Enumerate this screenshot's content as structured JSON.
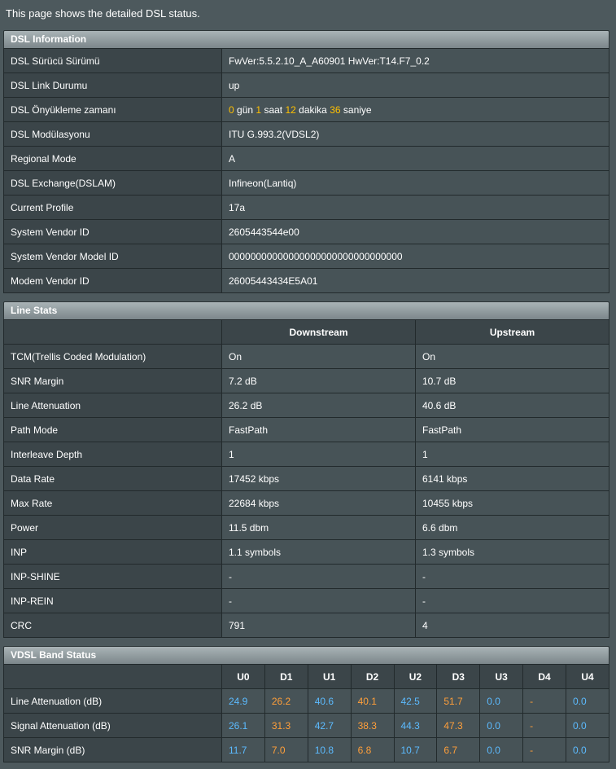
{
  "intro": "This page shows the detailed DSL status.",
  "dsl_info": {
    "title": "DSL Information",
    "rows": [
      {
        "label": "DSL Sürücü Sürümü",
        "value": "FwVer:5.5.2.10_A_A60901 HwVer:T14.F7_0.2"
      },
      {
        "label": "DSL Link Durumu",
        "value": "up"
      },
      {
        "label": "DSL Önyükleme zamanı",
        "value": ""
      },
      {
        "label": "DSL Modülasyonu",
        "value": "ITU G.993.2(VDSL2)"
      },
      {
        "label": "Regional Mode",
        "value": "A"
      },
      {
        "label": "DSL Exchange(DSLAM)",
        "value": "Infineon(Lantiq)"
      },
      {
        "label": "Current Profile",
        "value": "17a"
      },
      {
        "label": "System Vendor ID",
        "value": "2605443544e00"
      },
      {
        "label": "System Vendor Model ID",
        "value": "00000000000000000000000000000000"
      },
      {
        "label": "Modem Vendor ID",
        "value": "26005443434E5A01"
      }
    ],
    "uptime": {
      "days": "0",
      "days_unit": "gün",
      "hours": "1",
      "hours_unit": "saat",
      "minutes": "12",
      "minutes_unit": "dakika",
      "seconds": "36",
      "seconds_unit": "saniye"
    }
  },
  "line_stats": {
    "title": "Line Stats",
    "col_downstream": "Downstream",
    "col_upstream": "Upstream",
    "rows": [
      {
        "label": "TCM(Trellis Coded Modulation)",
        "down": "On",
        "up": "On"
      },
      {
        "label": "SNR Margin",
        "down": "7.2 dB",
        "up": "10.7 dB"
      },
      {
        "label": "Line Attenuation",
        "down": "26.2 dB",
        "up": "40.6 dB"
      },
      {
        "label": "Path Mode",
        "down": "FastPath",
        "up": "FastPath"
      },
      {
        "label": "Interleave Depth",
        "down": "1",
        "up": "1"
      },
      {
        "label": "Data Rate",
        "down": "17452 kbps",
        "up": "6141 kbps"
      },
      {
        "label": "Max Rate",
        "down": "22684 kbps",
        "up": "10455 kbps"
      },
      {
        "label": "Power",
        "down": "11.5 dbm",
        "up": "6.6 dbm"
      },
      {
        "label": "INP",
        "down": "1.1 symbols",
        "up": "1.3 symbols"
      },
      {
        "label": "INP-SHINE",
        "down": "-",
        "up": "-"
      },
      {
        "label": "INP-REIN",
        "down": "-",
        "up": "-"
      },
      {
        "label": "CRC",
        "down": "791",
        "up": "4"
      }
    ]
  },
  "vdsl_band": {
    "title": "VDSL Band Status",
    "bands": [
      "U0",
      "D1",
      "U1",
      "D2",
      "U2",
      "D3",
      "U3",
      "D4",
      "U4"
    ],
    "colors": {
      "upstream": "#5cbbff",
      "downstream": "#ff9f3a"
    },
    "rows": [
      {
        "label": "Line Attenuation (dB)",
        "values": [
          "24.9",
          "26.2",
          "40.6",
          "40.1",
          "42.5",
          "51.7",
          "0.0",
          "-",
          "0.0"
        ]
      },
      {
        "label": "Signal Attenuation (dB)",
        "values": [
          "26.1",
          "31.3",
          "42.7",
          "38.3",
          "44.3",
          "47.3",
          "0.0",
          "-",
          "0.0"
        ]
      },
      {
        "label": "SNR Margin (dB)",
        "values": [
          "11.7",
          "7.0",
          "10.8",
          "6.8",
          "10.7",
          "6.7",
          "0.0",
          "-",
          "0.0"
        ]
      }
    ]
  }
}
